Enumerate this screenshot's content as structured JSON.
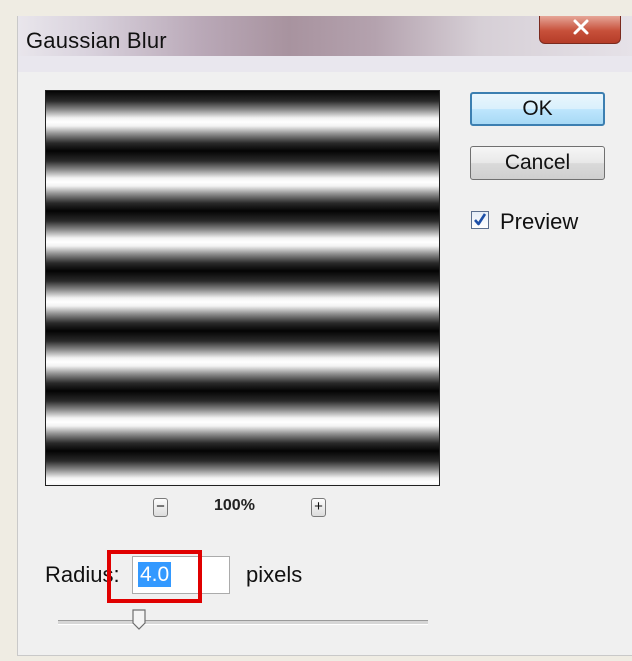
{
  "dialog": {
    "title": "Gaussian Blur",
    "close_icon": "close-icon"
  },
  "buttons": {
    "ok_label": "OK",
    "cancel_label": "Cancel"
  },
  "preview": {
    "checkbox_label": "Preview",
    "checked": true
  },
  "zoom": {
    "out_label": "−",
    "in_label": "+",
    "level": "100%"
  },
  "radius": {
    "label": "Radius:",
    "value": "4.0",
    "unit": "pixels",
    "slider_fraction": 0.22
  },
  "colors": {
    "highlight": "#e00000",
    "selection": "#3399ff",
    "close_button": "#c7503a"
  }
}
